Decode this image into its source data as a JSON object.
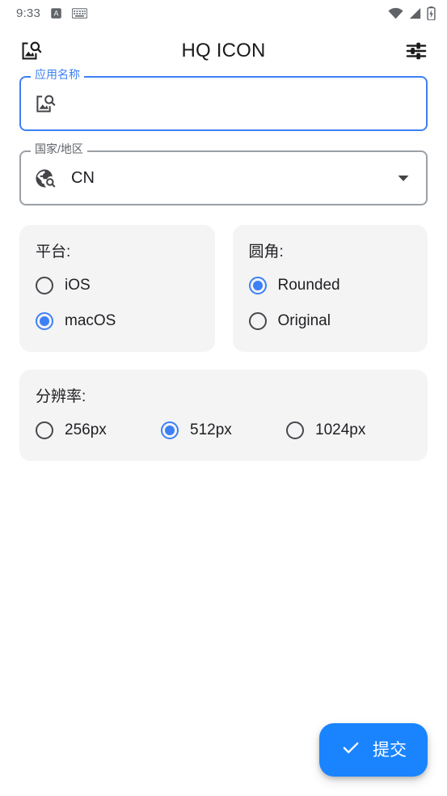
{
  "status_bar": {
    "time": "9:33",
    "left_icons": [
      "letter-a-badge-icon",
      "keyboard-icon"
    ],
    "right_icons": [
      "wifi-icon",
      "cell-signal-icon",
      "battery-charging-icon"
    ]
  },
  "app_bar": {
    "title": "HQ ICON",
    "leading_icon": "image-search-icon",
    "trailing_icon": "tune-icon"
  },
  "form": {
    "app_name": {
      "label": "应用名称",
      "value": "",
      "placeholder": "",
      "icon": "image-search-icon",
      "focused": true,
      "accent_color": "#3d80f5"
    },
    "country": {
      "label": "国家/地区",
      "value": "CN",
      "icon": "travel-explore-icon",
      "caret_icon": "dropdown-caret-icon"
    },
    "platform": {
      "title": "平台:",
      "options": [
        {
          "label": "iOS",
          "selected": false
        },
        {
          "label": "macOS",
          "selected": true
        }
      ]
    },
    "corner": {
      "title": "圆角:",
      "options": [
        {
          "label": "Rounded",
          "selected": true
        },
        {
          "label": "Original",
          "selected": false
        }
      ]
    },
    "resolution": {
      "title": "分辨率:",
      "options": [
        {
          "label": "256px",
          "selected": false
        },
        {
          "label": "512px",
          "selected": true
        },
        {
          "label": "1024px",
          "selected": false
        }
      ]
    }
  },
  "submit": {
    "label": "提交",
    "icon": "check-icon",
    "color": "#1a84ff"
  }
}
